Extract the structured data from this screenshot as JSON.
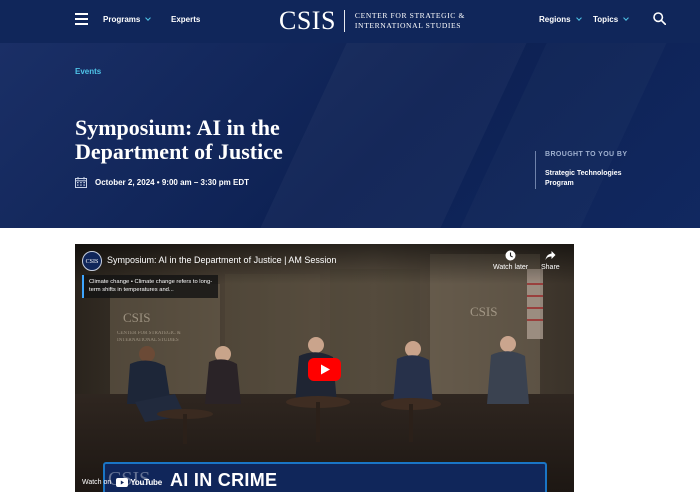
{
  "header": {
    "menu_icon": "hamburger-menu-icon",
    "nav_left": [
      {
        "label": "Programs",
        "has_dropdown": true
      },
      {
        "label": "Experts",
        "has_dropdown": false
      }
    ],
    "logo": {
      "mark": "CSIS",
      "line1": "CENTER FOR STRATEGIC &",
      "line2": "INTERNATIONAL STUDIES"
    },
    "nav_right": [
      {
        "label": "Regions",
        "has_dropdown": true
      },
      {
        "label": "Topics",
        "has_dropdown": true
      }
    ],
    "search_icon": "search-icon",
    "bg_color": "#10265a",
    "accent_color": "#4fc4e8"
  },
  "hero": {
    "eyebrow": "Events",
    "title": "Symposium: AI in the Department of Justice",
    "date": "October 2, 2024 • 9:00 am – 3:30 pm EDT",
    "calendar_icon": "calendar-icon",
    "brought_by_label": "BROUGHT TO YOU BY",
    "brought_by_program": "Strategic Technologies Program"
  },
  "video": {
    "channel_avatar_text": "CSIS",
    "title": "Symposium: AI in the Department of Justice | AM Session",
    "watch_later": "Watch later",
    "share": "Share",
    "info_card": "Climate change • Climate change refers to long-term shifts in temperatures and...",
    "watch_on": "Watch on",
    "youtube_brand": "YouTube",
    "backdrop_logo": "CSIS",
    "backdrop_line1": "CENTER FOR STRATEGIC &",
    "backdrop_line2": "INTERNATIONAL STUDIES",
    "lower_third_logo": "CSIS",
    "lower_third_text": "AI IN CRIME",
    "play_icon": "youtube-play-icon"
  }
}
